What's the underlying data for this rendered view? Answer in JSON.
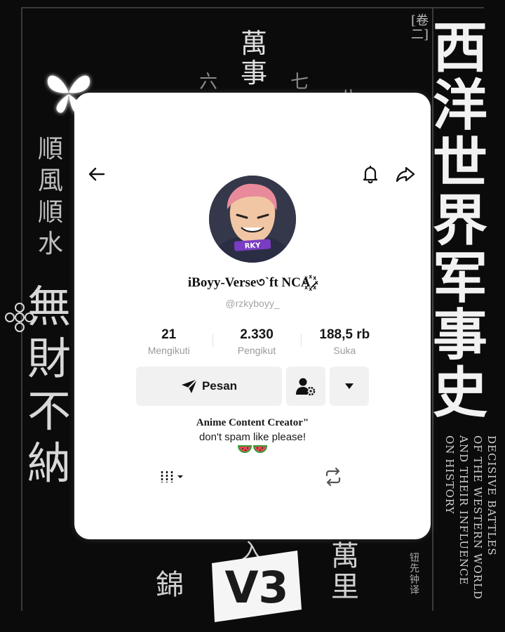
{
  "background": {
    "big_column": "西洋世界军事史",
    "left_column": "無財不納",
    "small_column": "順風順水",
    "top_column": "萬事",
    "top_row_left": "六",
    "top_row_mid": "七",
    "top_row_right": "八",
    "volume_label": "[卷二]",
    "bottom_left_char": "錦",
    "bottom_right_chars": "萬里",
    "bottom_center_char": "入",
    "translator": "钮先钟 译",
    "english_lines": [
      "DECISIVE BATTLES",
      "OF THE WESTERN WORLD",
      "AND THEIR INFLUENCE",
      "ON HISTORY"
    ],
    "logo_text": "V3"
  },
  "header": {
    "back_icon": "arrow-left-icon",
    "bell_icon": "bell-icon",
    "share_icon": "share-arrow-icon"
  },
  "profile": {
    "display_name": "iBoyy-Verse৩`ft NCA꙰⸝",
    "username": "@rzkyboyy_",
    "avatar_badge": "RKY"
  },
  "stats": [
    {
      "value": "21",
      "label": "Mengikuti"
    },
    {
      "value": "2.330",
      "label": "Pengikut"
    },
    {
      "value": "188,5 rb",
      "label": "Suka"
    }
  ],
  "actions": {
    "message_label": "Pesan",
    "message_icon": "send-icon",
    "friends_icon": "user-settings-icon",
    "more_icon": "caret-down-icon"
  },
  "bio": {
    "line1": "Anime Content Creator\"",
    "line2": "don't spam like please!",
    "emoji": "watermelon"
  },
  "tabs": {
    "grid_icon": "video-grid-icon",
    "repost_icon": "repost-icon"
  }
}
